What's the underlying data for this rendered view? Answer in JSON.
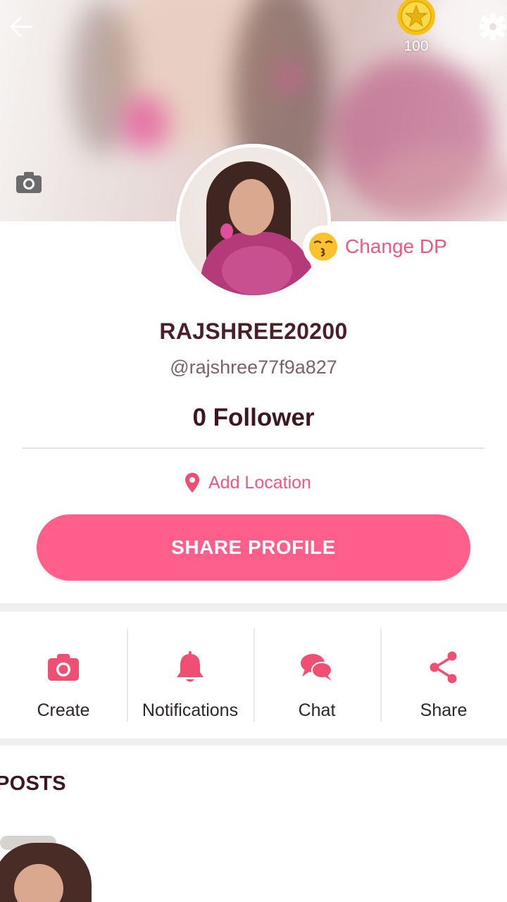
{
  "cover": {
    "coin_count": "100"
  },
  "profile": {
    "change_dp_label": "Change DP",
    "display_name": "RAJSHREE20200",
    "handle": "@rajshree77f9a827",
    "followers": "0 Follower",
    "add_location_label": "Add Location",
    "share_profile_label": "SHARE PROFILE"
  },
  "actions": [
    {
      "label": "Create",
      "icon": "camera-icon"
    },
    {
      "label": "Notifications",
      "icon": "bell-icon"
    },
    {
      "label": "Chat",
      "icon": "chat-bubbles-icon"
    },
    {
      "label": "Share",
      "icon": "share-icon"
    }
  ],
  "posts": {
    "title": "POSTS"
  },
  "colors": {
    "accent": "#ff5f8a",
    "accent_text": "#e85a80",
    "name_text": "#4a1f2a",
    "icon_pink": "#ee4f73"
  }
}
